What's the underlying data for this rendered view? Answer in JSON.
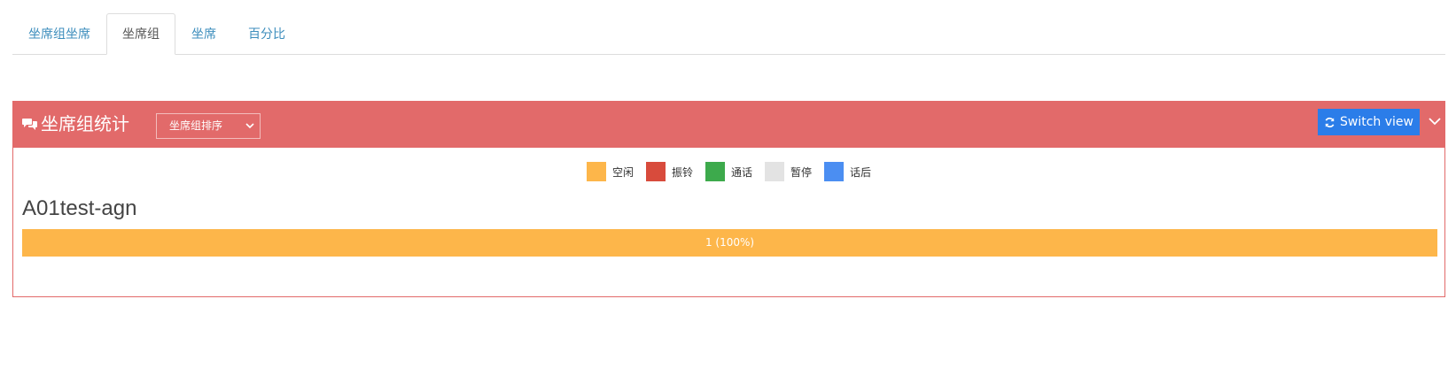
{
  "tabs": [
    {
      "label": "坐席组坐席",
      "active": false
    },
    {
      "label": "坐席组",
      "active": true
    },
    {
      "label": "坐席",
      "active": false
    },
    {
      "label": "百分比",
      "active": false
    }
  ],
  "panel": {
    "title": "坐席组统计",
    "sort_select": "坐席组排序",
    "switch_label": "Switch view"
  },
  "legend": [
    {
      "label": "空闲",
      "color": "#fdb64a"
    },
    {
      "label": "振铃",
      "color": "#d84b3c"
    },
    {
      "label": "通话",
      "color": "#3daa4c"
    },
    {
      "label": "暂停",
      "color": "#e3e3e3"
    },
    {
      "label": "话后",
      "color": "#4b8ef2"
    }
  ],
  "group": {
    "name": "A01test-agn",
    "bar_label": "1 (100%)",
    "percent": 100
  },
  "colors": {
    "panel_header": "#e26a6a",
    "tab_link": "#3c8dbc",
    "switch_button": "#2b7de9"
  }
}
